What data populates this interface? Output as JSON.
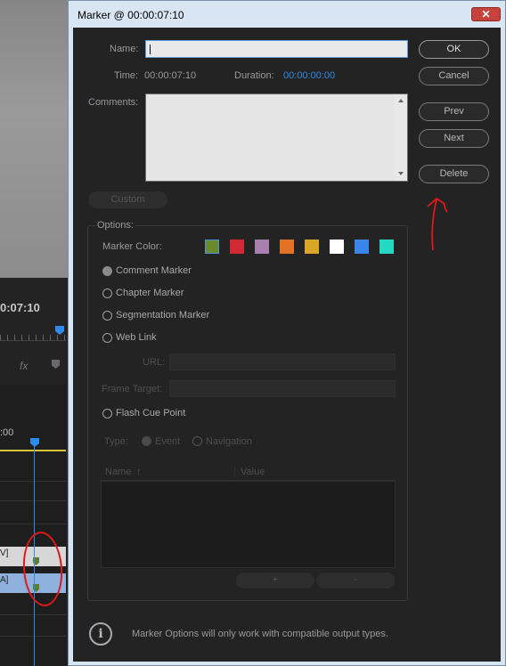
{
  "background_app": {
    "timecode": "0:07:10",
    "fx_label": "fx",
    "timeline_time": ":00",
    "clip1_label": "V]",
    "clip2_label": "A]"
  },
  "dialog": {
    "title": "Marker @ 00:00:07:10",
    "close_label": "✕",
    "name_label": "Name:",
    "name_value": "",
    "time_label": "Time:",
    "time_value": "00:00:07:10",
    "duration_label": "Duration:",
    "duration_value": "00:00:00:00",
    "comments_label": "Comments:",
    "comments_value": "",
    "buttons": {
      "ok": "OK",
      "cancel": "Cancel",
      "prev": "Prev",
      "next": "Next",
      "delete": "Delete",
      "custom": "Custom"
    },
    "options": {
      "group_label": "Options:",
      "marker_color_label": "Marker Color:",
      "colors": [
        "#6b8a2a",
        "#d22a34",
        "#a97fae",
        "#e27324",
        "#d9a628",
        "#ffffff",
        "#3a86e8",
        "#24d8c2"
      ],
      "marker_types": [
        {
          "label": "Comment Marker",
          "checked": true
        },
        {
          "label": "Chapter Marker",
          "checked": false
        },
        {
          "label": "Segmentation Marker",
          "checked": false
        },
        {
          "label": "Web Link",
          "checked": false
        }
      ],
      "url_label": "URL:",
      "frame_target_label": "Frame Target:",
      "flash_cue_label": "Flash Cue Point",
      "type_label": "Type:",
      "type_event": "Event",
      "type_navigation": "Navigation",
      "table_headers": [
        "Name",
        "Value"
      ],
      "add_label": "+",
      "remove_label": "-"
    },
    "info_text": "Marker Options will only work with compatible output types."
  }
}
